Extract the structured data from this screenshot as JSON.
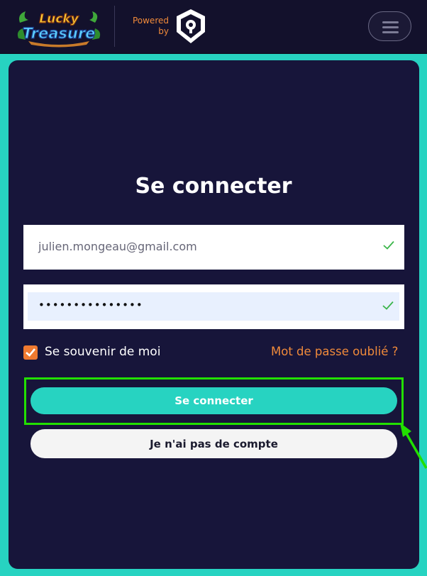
{
  "header": {
    "logo_text_1": "Lucky",
    "logo_text_2": "Treasure",
    "powered_line1": "Powered",
    "powered_line2": "by",
    "menu_icon": "hamburger-menu-icon"
  },
  "login": {
    "title": "Se connecter",
    "email_value": "julien.mongeau@gmail.com",
    "password_value": "•••••••••••••••",
    "remember_label": "Se souvenir de moi",
    "remember_checked": true,
    "forgot_label": "Mot de passe oublié ?",
    "submit_label": "Se connecter",
    "no_account_label": "Je n'ai pas de compte"
  },
  "colors": {
    "header_bg": "#13112c",
    "accent_teal": "#27d3c1",
    "panel_bg": "#17153a",
    "orange": "#f08a3a",
    "highlight_green": "#22e000"
  }
}
